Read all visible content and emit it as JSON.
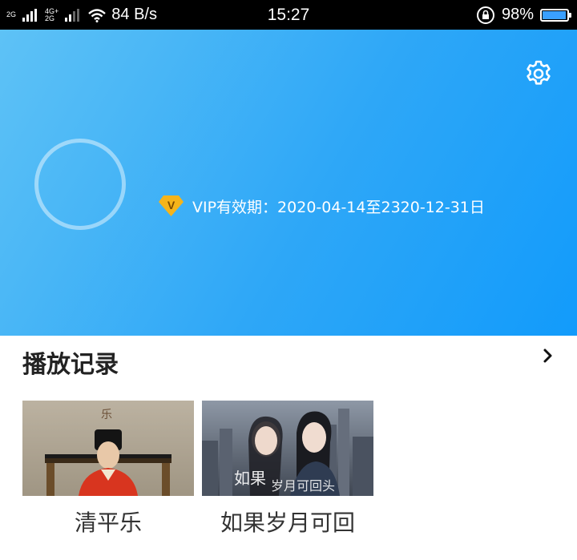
{
  "status_bar": {
    "network1": "2G",
    "network2_top": "4G+",
    "network2_bottom": "2G",
    "speed": "84 B/s",
    "time": "15:27",
    "battery": "98%",
    "battery_level": 0.98
  },
  "profile": {
    "vip_text": "VIP有效期：2020-04-14至2320-12-31日",
    "badge_letter": "V"
  },
  "history": {
    "title": "播放记录",
    "items": [
      {
        "title": "清平乐"
      },
      {
        "title": "如果岁月可回"
      }
    ]
  },
  "colors": {
    "header_start": "#5ec2f6",
    "header_end": "#129bfb",
    "vip_badge": "#f5b41a"
  }
}
